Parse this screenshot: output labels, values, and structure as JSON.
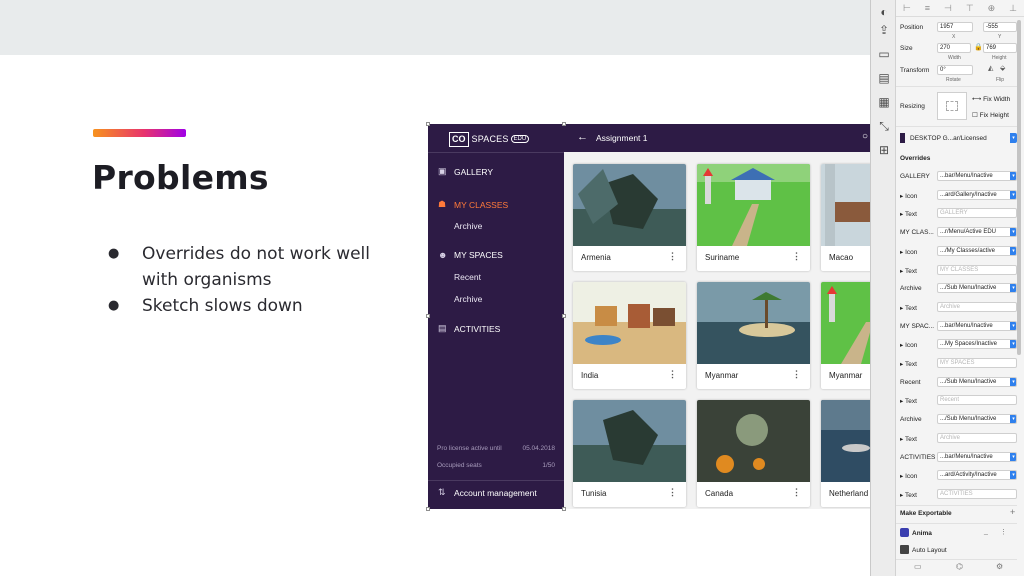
{
  "slide": {
    "title": "Problems",
    "bullets": [
      "Overrides do not work well with organisms",
      "Sketch slows down"
    ],
    "bullet_glyph": "●",
    "accent_gradient": [
      "#f7931e",
      "#e8336d",
      "#a000e6"
    ]
  },
  "app": {
    "logo_box": "CO",
    "logo_text": "SPACES",
    "logo_badge": "EDU",
    "top_title": "Assignment 1",
    "sidebar": {
      "items": [
        {
          "label": "GALLERY",
          "icon": "gallery-icon"
        },
        {
          "label": "MY CLASSES",
          "icon": "classes-icon",
          "active": true
        },
        {
          "label": "Archive"
        },
        {
          "label": "MY SPACES",
          "icon": "spaces-icon"
        },
        {
          "label": "Recent"
        },
        {
          "label": "Archive"
        },
        {
          "label": "ACTIVITIES",
          "icon": "activities-icon"
        }
      ],
      "license_label": "Pro license active until",
      "license_value": "05.04.2018",
      "seats_label": "Occupied seats",
      "seats_value": "1/50",
      "account": "Account management"
    },
    "cards": [
      {
        "label": "Armenia"
      },
      {
        "label": "Suriname"
      },
      {
        "label": "Macao"
      },
      {
        "label": "India"
      },
      {
        "label": "Myanmar"
      },
      {
        "label": "Myanmar"
      },
      {
        "label": "Tunisia"
      },
      {
        "label": "Canada"
      },
      {
        "label": "Netherland"
      }
    ],
    "card_menu": "⋮",
    "colors": {
      "sidebar": "#2d1b45",
      "active": "#ff7a3a"
    }
  },
  "inspector": {
    "position_label": "Position",
    "x": "1957",
    "y": "-555",
    "x_caption": "X",
    "y_caption": "Y",
    "size_label": "Size",
    "width": "270",
    "height": "769",
    "width_caption": "Width",
    "height_caption": "Height",
    "transform_label": "Transform",
    "rotate": "0°",
    "rotate_caption": "Rotate",
    "flip_caption": "Flip",
    "resizing_label": "Resizing",
    "fix_width": "Fix Width",
    "fix_height": "Fix Height",
    "symbol": "DESKTOP G...ar/Licensed",
    "overrides_label": "Overrides",
    "overrides": [
      {
        "label": "GALLERY",
        "value": "...bar/Menu/Inactive",
        "placeholder": false
      },
      {
        "label": "▸ Icon",
        "value": "...ard/Gallery/Inactive",
        "placeholder": false
      },
      {
        "label": "▸ Text",
        "value": "GALLERY",
        "placeholder": true
      },
      {
        "label": "MY CLAS...",
        "value": "...r/Menu/Active EDU",
        "placeholder": false
      },
      {
        "label": "▸ Icon",
        "value": ".../My Classes/active",
        "placeholder": false
      },
      {
        "label": "▸ Text",
        "value": "MY CLASSES",
        "placeholder": true
      },
      {
        "label": "Archive",
        "value": ".../Sub Menu/Inactive",
        "placeholder": false
      },
      {
        "label": "▸ Text",
        "value": "Archive",
        "placeholder": true
      },
      {
        "label": "MY SPAC...",
        "value": "...bar/Menu/Inactive",
        "placeholder": false
      },
      {
        "label": "▸ Icon",
        "value": "...My Spaces/Inactive",
        "placeholder": false
      },
      {
        "label": "▸ Text",
        "value": "MY SPACES",
        "placeholder": true
      },
      {
        "label": "Recent",
        "value": ".../Sub Menu/Inactive",
        "placeholder": false
      },
      {
        "label": "▸ Text",
        "value": "Recent",
        "placeholder": true
      },
      {
        "label": "Archive",
        "value": ".../Sub Menu/Inactive",
        "placeholder": false
      },
      {
        "label": "▸ Text",
        "value": "Archive",
        "placeholder": true
      },
      {
        "label": "ACTIVITIES",
        "value": "...bar/Menu/Inactive",
        "placeholder": false
      },
      {
        "label": "▸ Icon",
        "value": "...ard/Activity/Inactive",
        "placeholder": false
      },
      {
        "label": "▸ Text",
        "value": "ACTIVITIES",
        "placeholder": true
      }
    ],
    "make_exportable": "Make Exportable",
    "anima": "Anima",
    "auto_layout": "Auto Layout",
    "accent": "#2f80ed"
  }
}
